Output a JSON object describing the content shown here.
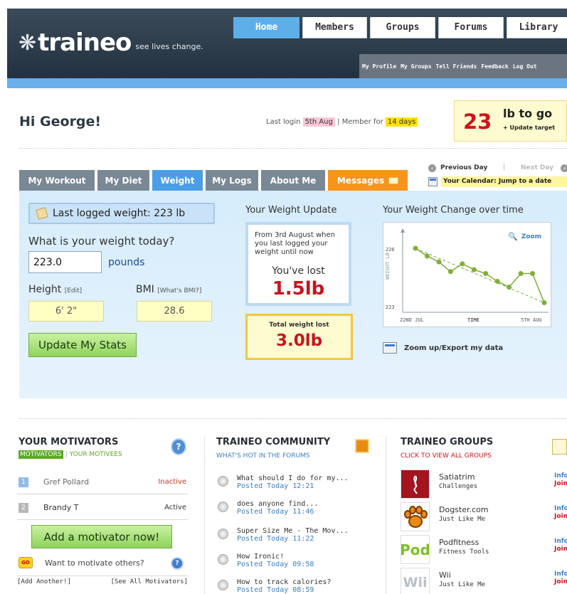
{
  "brand": {
    "name": "traineo",
    "tagline": "see lives change."
  },
  "nav": {
    "tabs": [
      {
        "label": "Home"
      },
      {
        "label": "Members"
      },
      {
        "label": "Groups"
      },
      {
        "label": "Forums"
      },
      {
        "label": "Library"
      }
    ],
    "subnav": [
      "My Profile",
      "My Groups",
      "Tell Friends",
      "Feedback",
      "Log Out"
    ]
  },
  "greeting": {
    "title": "Hi George!",
    "last_login_label": "Last login",
    "last_login_value": "5th Aug",
    "member_for_label": "| Member for",
    "member_for_value": "14 days"
  },
  "target": {
    "lb_value": "23",
    "lb_label": "lb to go",
    "update_label": "+ Update target"
  },
  "daynav": {
    "prev": "Previous Day",
    "separator": "|",
    "next": "Next Day",
    "calendar": "Your Calendar: Jump to a date"
  },
  "tabs": [
    {
      "label": "My Workout"
    },
    {
      "label": "My Diet"
    },
    {
      "label": "Weight"
    },
    {
      "label": "My Logs"
    },
    {
      "label": "About Me"
    },
    {
      "label": "Messages"
    }
  ],
  "weight_form": {
    "last_logged": "Last logged weight: 223 lb",
    "question": "What is your weight today?",
    "weight_value": "223.0",
    "unit": "pounds",
    "height_label": "Height",
    "height_edit": "[Edit]",
    "bmi_label": "BMI",
    "bmi_help": "[What's BMI?]",
    "height_value": "6' 2\"",
    "bmi_value": "28.6",
    "update_button": "Update My Stats"
  },
  "weight_update": {
    "title": "Your Weight Update",
    "from_text": "From 3rd August when you last logged your weight until now",
    "lost_label": "You've lost",
    "lost_value": "1.5lb",
    "total_label": "Total weight lost",
    "total_value": "3.0lb"
  },
  "weight_change": {
    "title": "Your Weight Change over time",
    "zoom_label": "Zoom",
    "export_label": "Zoom up/Export my data"
  },
  "chart_data": {
    "type": "line",
    "xlabel": "TIME",
    "ylabel": "WEIGHT LB",
    "x_tick_labels": [
      "22ND JUL",
      "5TH AUG"
    ],
    "y_tick_labels": [
      "226",
      "223"
    ],
    "ylim": [
      223,
      226
    ],
    "series": [
      {
        "values": [
          226.0,
          225.6,
          225.3,
          224.8,
          225.2,
          224.9,
          224.7,
          224.3,
          224.0,
          224.7,
          224.7,
          223.2
        ]
      }
    ],
    "trendline": {
      "start": 226.0,
      "end": 223.2
    },
    "colors": {
      "line": "#7fae3a",
      "trend": "#7fae3a",
      "axis": "#8a98a6"
    }
  },
  "motivators": {
    "title": "YOUR MOTIVATORS",
    "tab_active": "MOTIVATORS",
    "tab_sep": "|",
    "tab_other": "YOUR MOTIVEES",
    "rows": [
      {
        "num": "1",
        "name": "Gref Pollard",
        "status": "Inactive"
      },
      {
        "num": "2",
        "name": "Brandy T",
        "status": "Active"
      }
    ],
    "add_button": "Add a motivator now!",
    "go_badge": "GO",
    "want_text": "Want to motivate others?",
    "add_another": "[Add Another!]",
    "see_all": "[See All Motivators]"
  },
  "community": {
    "title": "TRAINEO COMMUNITY",
    "subtitle": "WHAT'S HOT IN THE FORUMS",
    "posts": [
      {
        "title": "What should I do for my...",
        "time": "Posted Today 12:21"
      },
      {
        "title": "does anyone find...",
        "time": "Posted Today 11:46"
      },
      {
        "title": "Super Size Me - The Mov...",
        "time": "Posted Today 11:22"
      },
      {
        "title": "How Ironic!",
        "time": "Posted Today 09:58"
      },
      {
        "title": "How to track calories?",
        "time": "Posted Today 08:59"
      }
    ]
  },
  "groups": {
    "title": "TRAINEO GROUPS",
    "subtitle": "CLICK TO VIEW ALL GROUPS",
    "items": [
      {
        "logo": "",
        "name": "Satiatrim",
        "category": "Challenges",
        "info": "Info",
        "join": "Join"
      },
      {
        "logo": "",
        "name": "Dogster.com",
        "category": "Just Like Me",
        "info": "Info",
        "join": "Join"
      },
      {
        "logo": "Pod",
        "name": "Podfitness",
        "category": "Fitness Tools",
        "info": "Info",
        "join": "Join"
      },
      {
        "logo": "Wii",
        "name": "Wii",
        "category": "Just Like Me",
        "info": "Info",
        "join": "Join"
      }
    ]
  },
  "colors": {
    "accent": "#4a9ee6",
    "header": "#2c3a49",
    "green": "#5aaa22",
    "red": "#d0121b",
    "orange": "#f7941d"
  }
}
